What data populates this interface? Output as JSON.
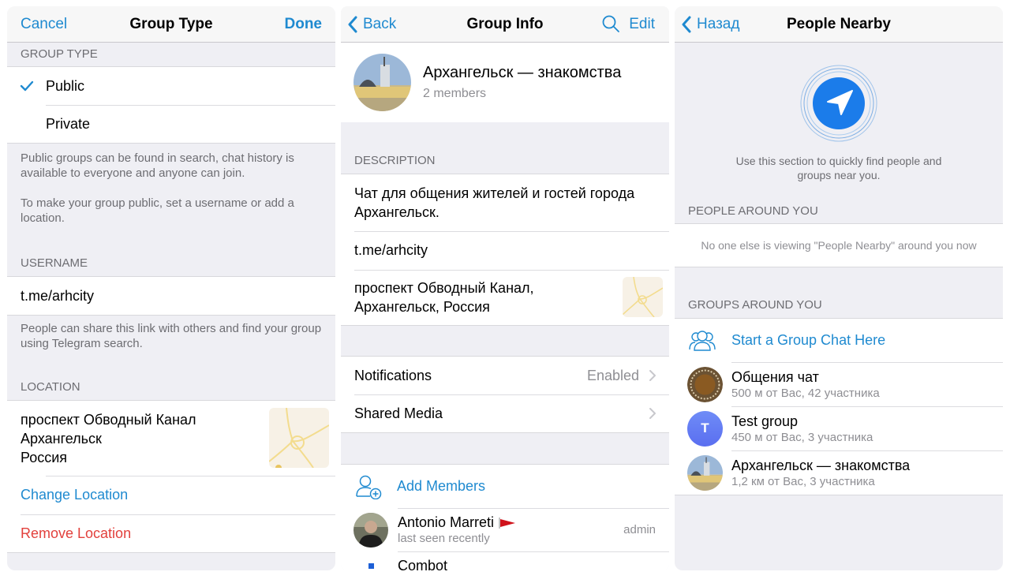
{
  "screen1": {
    "nav": {
      "cancel": "Cancel",
      "title": "Group Type",
      "done": "Done"
    },
    "group_type_header": "GROUP TYPE",
    "options": [
      {
        "label": "Public",
        "selected": true
      },
      {
        "label": "Private",
        "selected": false
      }
    ],
    "type_footer_1": "Public groups can be found in search, chat history is available to everyone and anyone can join.",
    "type_footer_2": "To make your group public, set a username or add a location.",
    "username_header": "USERNAME",
    "username_value": "t.me/arhcity",
    "username_footer": "People can share this link with others and find your group using Telegram search.",
    "location_header": "LOCATION",
    "location_lines": [
      "проспект Обводный Канал",
      "Архангельск",
      "Россия"
    ],
    "change_location": "Change Location",
    "remove_location": "Remove Location"
  },
  "screen2": {
    "nav": {
      "back": "Back",
      "title": "Group Info",
      "edit": "Edit"
    },
    "group_name": "Архангельск — знакомства",
    "members_count": "2 members",
    "description_header": "DESCRIPTION",
    "description": "Чат для общения жителей и гостей города Архангельск.",
    "link": "t.me/arhcity",
    "address_lines": [
      "проспект Обводный Канал,",
      "Архангельск, Россия"
    ],
    "notifications_label": "Notifications",
    "notifications_value": "Enabled",
    "shared_media_label": "Shared Media",
    "add_members": "Add Members",
    "members": [
      {
        "name": "Antonio Marreti",
        "status": "last seen recently",
        "role": "admin"
      },
      {
        "name": "Combot",
        "status": "",
        "role": ""
      }
    ]
  },
  "screen3": {
    "nav": {
      "back": "Назад",
      "title": "People Nearby"
    },
    "intro": "Use this section to quickly find people and groups near you.",
    "people_header": "PEOPLE AROUND YOU",
    "people_empty": "No one else is viewing \"People Nearby\" around you now",
    "groups_header": "GROUPS AROUND YOU",
    "start_group": "Start a Group Chat Here",
    "groups": [
      {
        "name": "Общения чат",
        "sub": "500 м от Вас, 42 участника",
        "avatar_letter": ""
      },
      {
        "name": "Test group",
        "sub": "450 м от Вас, 3 участника",
        "avatar_letter": "T"
      },
      {
        "name": "Архангельск — знакомства",
        "sub": "1,2 км от Вас, 3 участника",
        "avatar_letter": ""
      }
    ]
  },
  "colors": {
    "accent": "#1f8ad0",
    "destructive": "#e2403c",
    "background": "#efeff4",
    "location_blue": "#1b7cea"
  }
}
